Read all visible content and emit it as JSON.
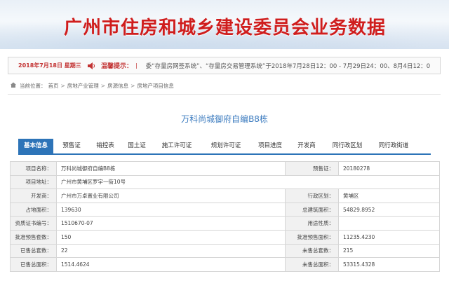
{
  "header": {
    "title": "广州市住房和城乡建设委员会业务数据"
  },
  "notice": {
    "date": "2018年7月18日 星期三",
    "warn_title": "温馨提示：",
    "sep": "|",
    "message": "委“存量房网签系统”、“存量房交易管理系统”于2018年7月28日12：00 - 7月29日24：00、8月4日12：0"
  },
  "breadcrumb": {
    "prefix": "当前位置：",
    "items": [
      "首页",
      "房地产业管理",
      "房源信息",
      "房地产项目信息"
    ],
    "arrow": ">"
  },
  "project": {
    "title": "万科尚城御府自编B8栋"
  },
  "tabs": [
    "基本信息",
    "预售证",
    "销控表",
    "国土证",
    "施工许可证",
    "规划许可证",
    "项目进度",
    "开发商",
    "同行政区划",
    "同行政街道"
  ],
  "info": {
    "rows": [
      {
        "l1": "项目名称：",
        "v1": "万科尚城御府自编B8栋",
        "l2": "预售证：",
        "v2": "20180278"
      },
      {
        "l1": "项目地址：",
        "v1": "广州市黄埔区罗宇一街10号"
      },
      {
        "l1": "开发商：",
        "v1": "广州市万卓置业有限公司",
        "l2": "行政区划：",
        "v2": "黄埔区"
      },
      {
        "l1": "占地面积：",
        "v1": "139630",
        "l2": "总建筑面积：",
        "v2": "54829.8952"
      },
      {
        "l1": "资质证书编号：",
        "v1": "1510670-07",
        "l2": "用途性质：",
        "v2": ""
      },
      {
        "l1": "批准预售套数：",
        "v1": "150",
        "l2": "批准预售面积：",
        "v2": "11235.4230"
      },
      {
        "l1": "已售总套数：",
        "v1": "22",
        "l2": "未售总套数：",
        "v2": "215"
      },
      {
        "l1": "已售总面积：",
        "v1": "1514.4624",
        "l2": "未售总面积：",
        "v2": "53315.4328"
      }
    ]
  },
  "colors": {
    "title_red": "#cf1d1d",
    "tab_blue": "#2d74b8",
    "project_blue": "#3b7bbf"
  },
  "icons": {
    "speaker": "speaker-icon",
    "home": "home-icon"
  }
}
